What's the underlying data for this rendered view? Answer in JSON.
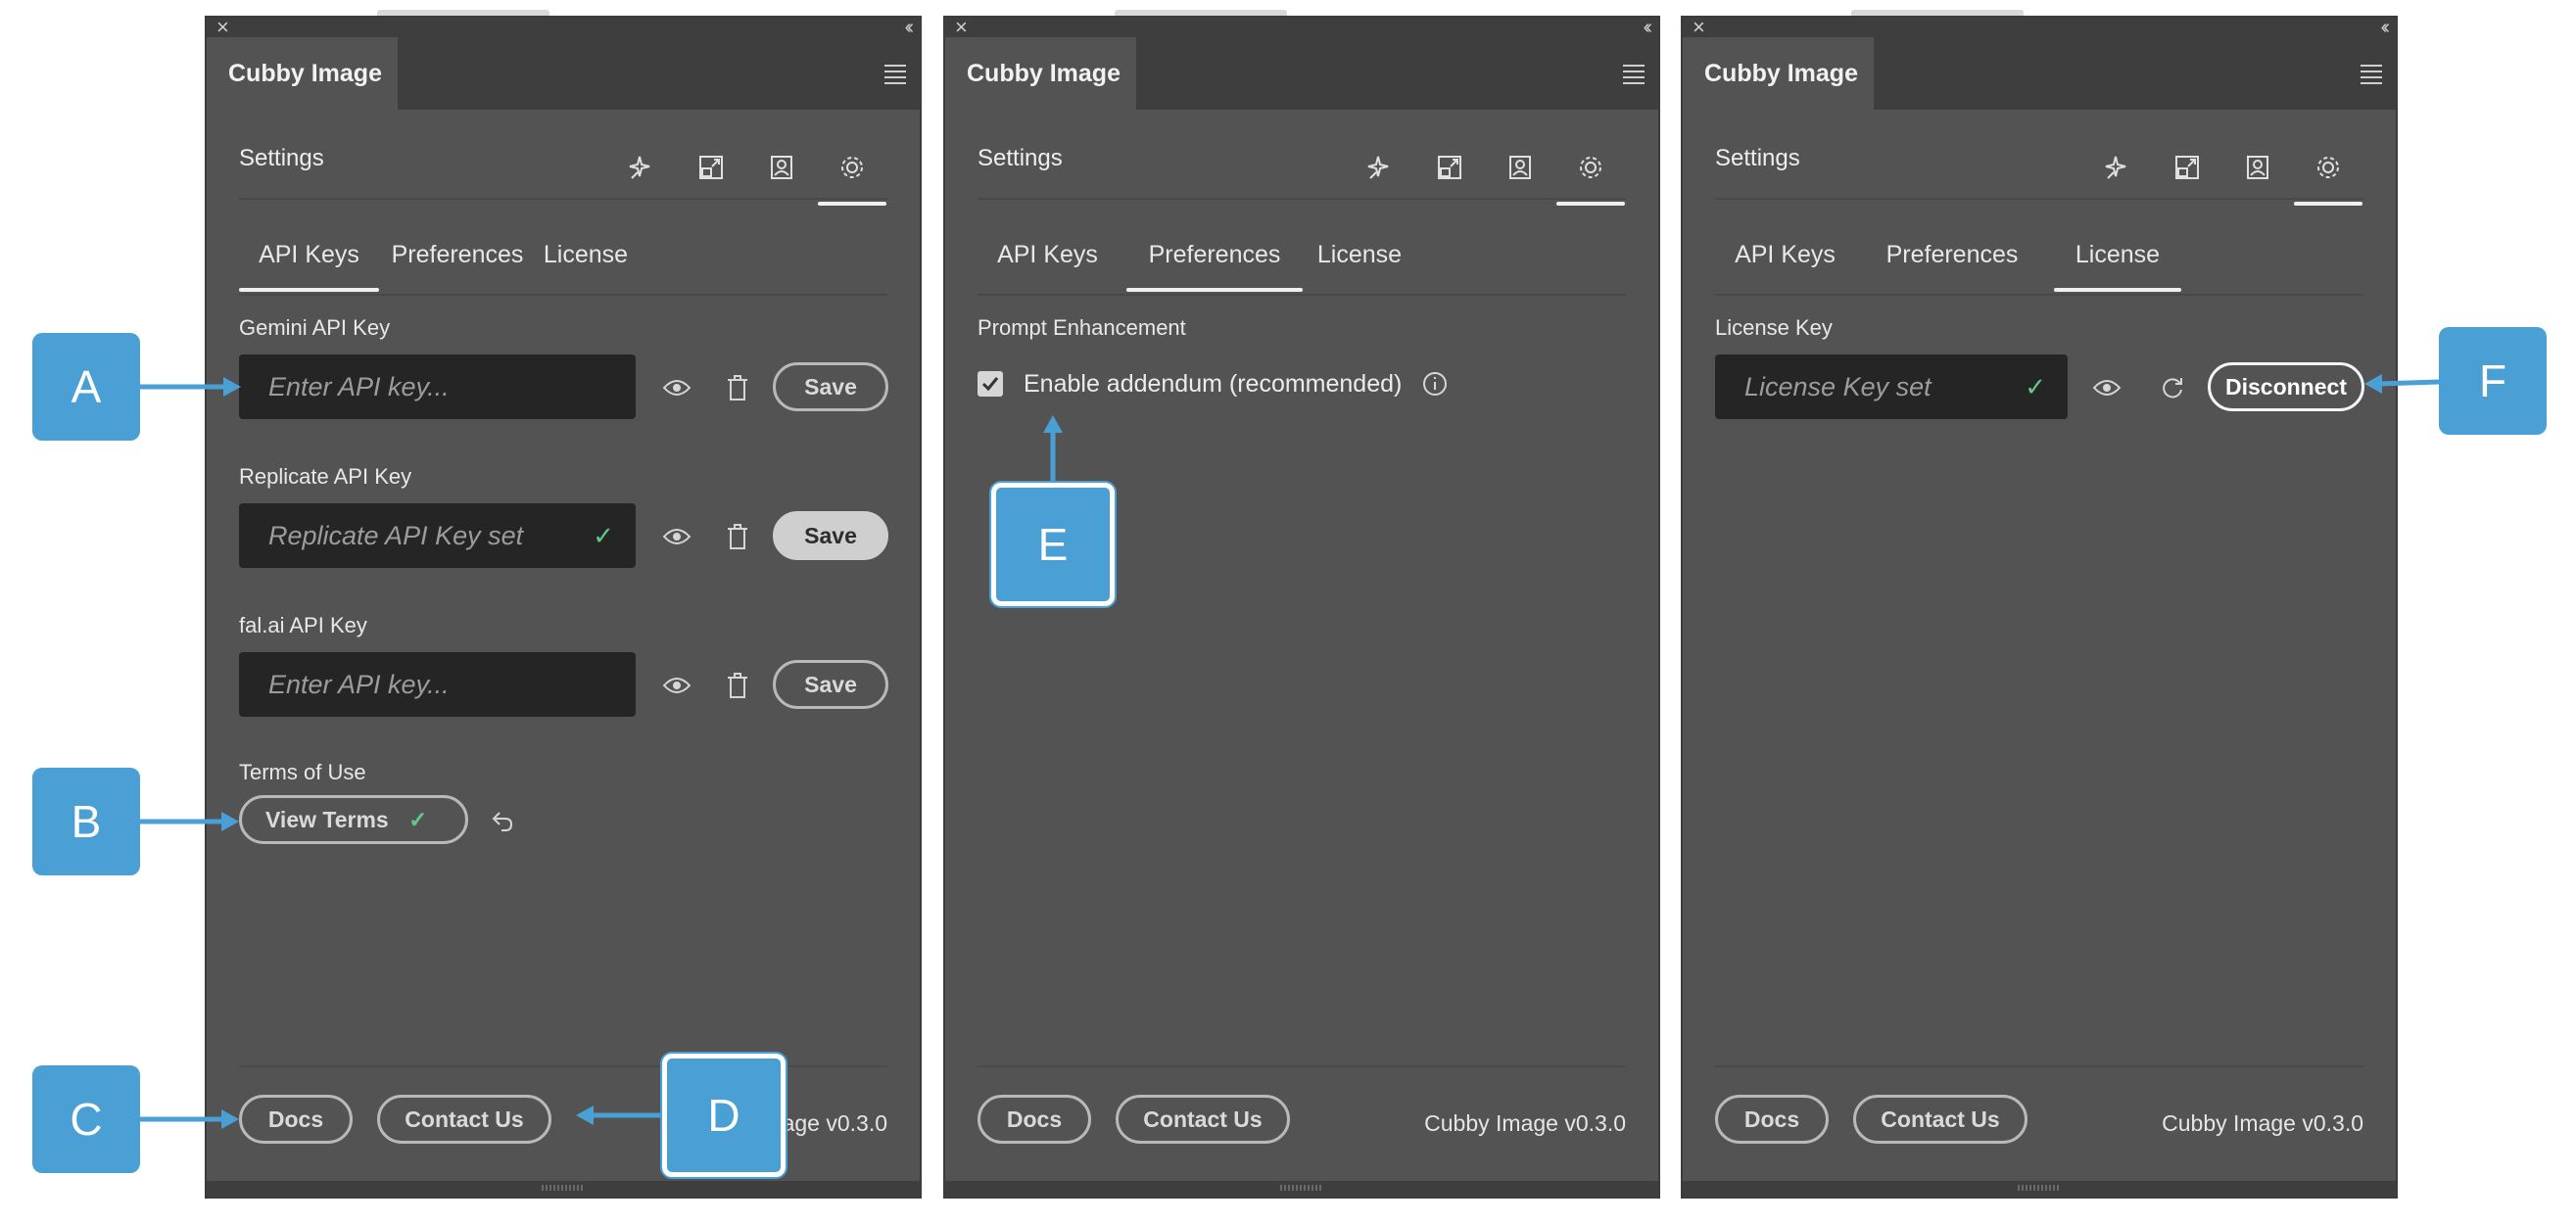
{
  "app_title": "Cubby Image",
  "section_title": "Settings",
  "toolbar_icons": [
    "sparkle-icon",
    "image-resize-icon",
    "portrait-icon",
    "gear-icon"
  ],
  "subtabs": [
    "API Keys",
    "Preferences",
    "License"
  ],
  "panel_api_keys": {
    "gemini": {
      "label": "Gemini API Key",
      "placeholder": "Enter API key...",
      "save": "Save"
    },
    "replicate": {
      "label": "Replicate API Key",
      "value": "Replicate API Key set",
      "save": "Save"
    },
    "fal": {
      "label": "fal.ai API Key",
      "placeholder": "Enter API key...",
      "save": "Save"
    },
    "terms": {
      "label": "Terms of Use",
      "button": "View Terms"
    }
  },
  "panel_preferences": {
    "section": "Prompt Enhancement",
    "checkbox_label": "Enable addendum (recommended)",
    "checked": true
  },
  "panel_license": {
    "label": "License Key",
    "value": "License Key set",
    "disconnect": "Disconnect"
  },
  "footer": {
    "docs": "Docs",
    "contact": "Contact Us",
    "version": "Cubby Image v0.3.0",
    "version_partial": "age v0.3.0"
  },
  "callouts": [
    "A",
    "B",
    "C",
    "D",
    "E",
    "F"
  ],
  "colors": {
    "panel": "#535353",
    "callout": "#4a9fd5",
    "check": "#5fc98a"
  }
}
